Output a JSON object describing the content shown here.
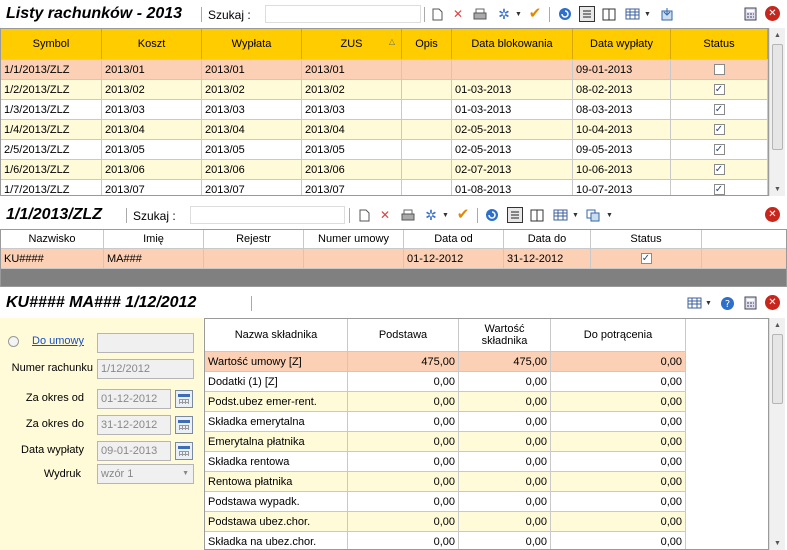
{
  "top": {
    "title": "Listy rachunków - 2013",
    "search_label": "Szukaj   :",
    "columns": [
      "Symbol",
      "Koszt",
      "Wypłata",
      "ZUS",
      "Opis",
      "Data blokowania",
      "Data wypłaty",
      "Status"
    ],
    "sort_mark": "△",
    "rows": [
      [
        "1/1/2013/ZLZ",
        "2013/01",
        "2013/01",
        "2013/01",
        "",
        "",
        "09-01-2013",
        false
      ],
      [
        "1/2/2013/ZLZ",
        "2013/02",
        "2013/02",
        "2013/02",
        "",
        "01-03-2013",
        "08-02-2013",
        true
      ],
      [
        "1/3/2013/ZLZ",
        "2013/03",
        "2013/03",
        "2013/03",
        "",
        "01-03-2013",
        "08-03-2013",
        true
      ],
      [
        "1/4/2013/ZLZ",
        "2013/04",
        "2013/04",
        "2013/04",
        "",
        "02-05-2013",
        "10-04-2013",
        true
      ],
      [
        "2/5/2013/ZLZ",
        "2013/05",
        "2013/05",
        "2013/05",
        "",
        "02-05-2013",
        "09-05-2013",
        true
      ],
      [
        "1/6/2013/ZLZ",
        "2013/06",
        "2013/06",
        "2013/06",
        "",
        "02-07-2013",
        "10-06-2013",
        true
      ],
      [
        "1/7/2013/ZLZ",
        "2013/07",
        "2013/07",
        "2013/07",
        "",
        "01-08-2013",
        "10-07-2013",
        true
      ]
    ]
  },
  "mid": {
    "title": "1/1/2013/ZLZ",
    "search_label": "Szukaj   :",
    "columns": [
      "Nazwisko",
      "Imię",
      "Rejestr",
      "Numer umowy",
      "Data od",
      "Data do",
      "Status"
    ],
    "rows": [
      [
        "KU####",
        "MA###",
        "",
        "",
        "01-12-2012",
        "31-12-2012",
        true
      ]
    ]
  },
  "bottom": {
    "title": "KU#### MA### 1/12/2012",
    "form": {
      "contract_link": "Do umowy",
      "contract_value": "",
      "account_number_label": "Numer rachunku",
      "account_number_value": "1/12/2012",
      "period_from_label": "Za okres od",
      "period_from_value": "01-12-2012",
      "period_to_label": "Za okres do",
      "period_to_value": "31-12-2012",
      "payout_date_label": "Data wypłaty",
      "payout_date_value": "09-01-2013",
      "printout_label": "Wydruk",
      "printout_value": "wzór 1"
    },
    "columns": [
      "Nazwa składnika",
      "Podstawa",
      "Wartość składnika",
      "Do potrącenia"
    ],
    "rows": [
      [
        "Wartość umowy [Z]",
        "475,00",
        "475,00",
        "0,00"
      ],
      [
        "Dodatki (1) [Z]",
        "0,00",
        "0,00",
        "0,00"
      ],
      [
        "Podst.ubez emer-rent.",
        "0,00",
        "0,00",
        "0,00"
      ],
      [
        "Składka emerytalna",
        "0,00",
        "0,00",
        "0,00"
      ],
      [
        "Emerytalna płatnika",
        "0,00",
        "0,00",
        "0,00"
      ],
      [
        "Składka rentowa",
        "0,00",
        "0,00",
        "0,00"
      ],
      [
        "Rentowa płatnika",
        "0,00",
        "0,00",
        "0,00"
      ],
      [
        "Podstawa wypadk.",
        "0,00",
        "0,00",
        "0,00"
      ],
      [
        "Podstawa ubez.chor.",
        "0,00",
        "0,00",
        "0,00"
      ],
      [
        "Składka na ubez.chor.",
        "0,00",
        "0,00",
        "0,00"
      ]
    ]
  },
  "colors": {
    "header_yellow": "#ffcc00",
    "selected_row": "#fbd0b4",
    "row_cream": "#fffbd9",
    "close_red": "#c8261c"
  },
  "icons": {
    "toolbar": [
      "new-document-icon",
      "delete-icon",
      "print-icon",
      "settings-gear-icon",
      "checkmark-icon",
      "refresh-icon",
      "grid-view-icon",
      "columns-icon",
      "table-options-icon",
      "export-icon",
      "calculator-icon",
      "close-icon",
      "help-icon"
    ]
  }
}
